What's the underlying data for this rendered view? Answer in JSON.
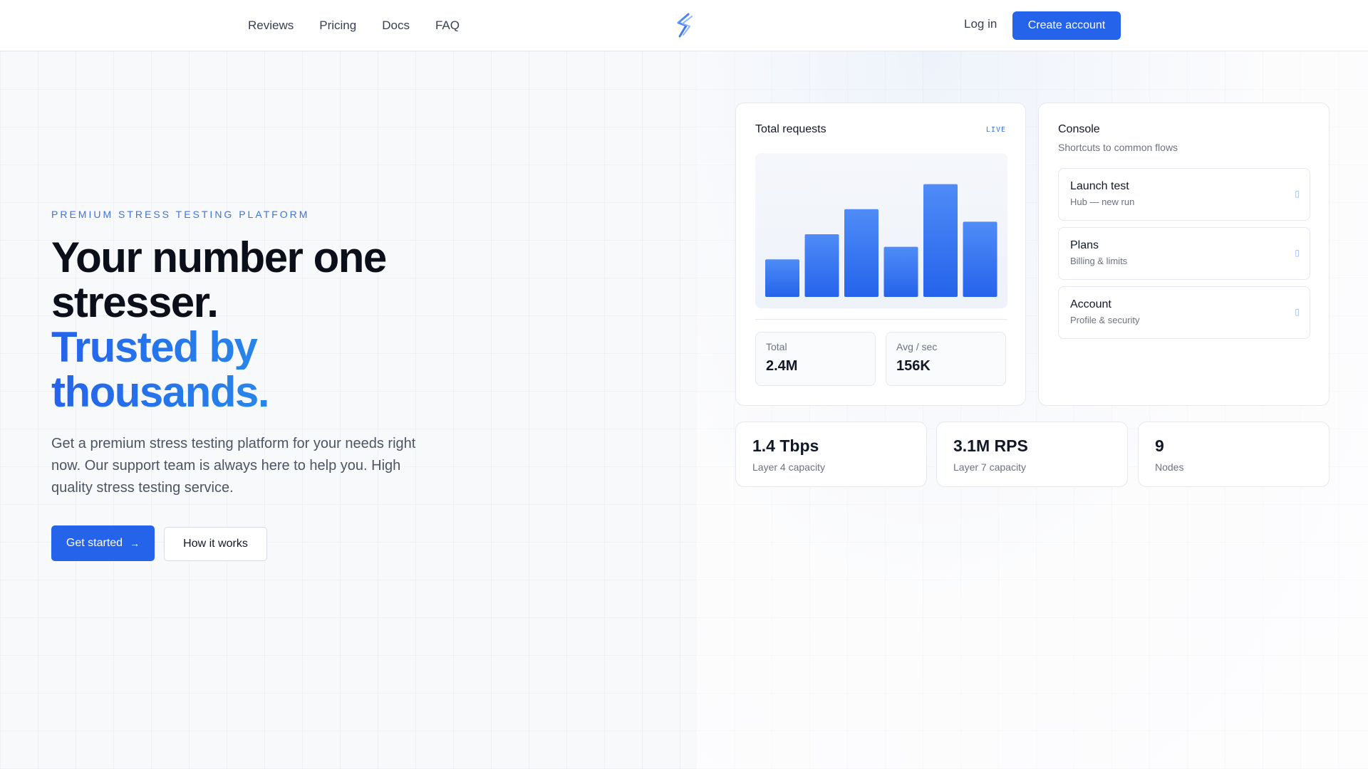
{
  "nav": {
    "links": [
      "Reviews",
      "Pricing",
      "Docs",
      "FAQ"
    ],
    "login": "Log in",
    "create_account": "Create account"
  },
  "hero": {
    "eyebrow": "PREMIUM STRESS TESTING PLATFORM",
    "headline_line1": "Your number one",
    "headline_line2": "stresser.",
    "headline_line3": "Trusted by",
    "headline_line4": "thousands.",
    "lead": "Get a premium stress testing platform for your needs right now. Our support team is always here to help you. High quality stress testing service.",
    "cta_primary": "Get started",
    "cta_primary_icon": "arrow-right-icon",
    "cta_secondary": "How it works"
  },
  "requests_card": {
    "title": "Total requests",
    "badge": "LIVE",
    "stats": [
      {
        "label": "Total",
        "value": "2.4M"
      },
      {
        "label": "Avg / sec",
        "value": "156K"
      }
    ]
  },
  "chart_data": {
    "type": "bar",
    "values": [
      30,
      50,
      70,
      40,
      90,
      60
    ],
    "ylim": [
      0,
      100
    ],
    "colors": {
      "top": "#4f8cf7",
      "bottom": "#2563eb"
    }
  },
  "console": {
    "title": "Console",
    "subtitle": "Shortcuts to common flows",
    "items": [
      {
        "title": "Launch test",
        "subtitle": "Hub — new run",
        "icon": "chevron-right-icon"
      },
      {
        "title": "Plans",
        "subtitle": "Billing & limits",
        "icon": "chevron-right-icon"
      },
      {
        "title": "Account",
        "subtitle": "Profile & security",
        "icon": "chevron-right-icon"
      }
    ]
  },
  "capacity": [
    {
      "value": "1.4 Tbps",
      "label": "Layer 4 capacity"
    },
    {
      "value": "3.1M RPS",
      "label": "Layer 7 capacity"
    },
    {
      "value": "9",
      "label": "Nodes"
    }
  ],
  "colors": {
    "accent": "#2563eb",
    "eyebrow": "#3b74e0"
  }
}
